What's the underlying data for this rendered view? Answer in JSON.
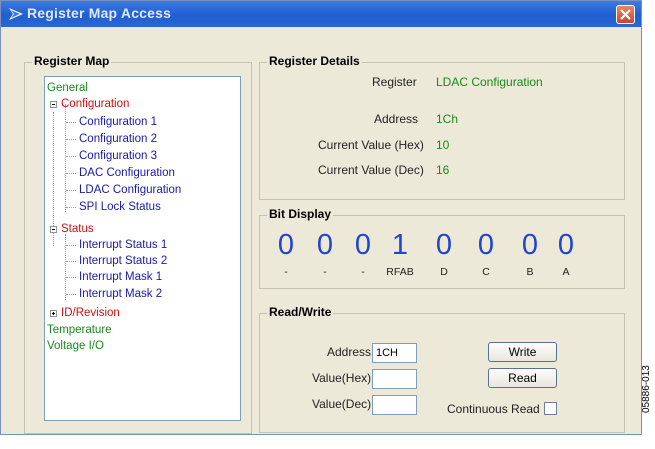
{
  "window": {
    "title": "Register Map Access",
    "close_icon": "close-icon"
  },
  "register_map": {
    "label": "Register Map",
    "items": [
      {
        "text": "General",
        "color": "#1a8a1a"
      },
      {
        "text": "Configuration",
        "color": "#cc1111",
        "expanded": true
      },
      {
        "text": "Configuration 1",
        "color": "#1a1aa8"
      },
      {
        "text": "Configuration 2",
        "color": "#1a1aa8"
      },
      {
        "text": "Configuration 3",
        "color": "#1a1aa8"
      },
      {
        "text": "DAC Configuration",
        "color": "#1a1aa8"
      },
      {
        "text": "LDAC Configuration",
        "color": "#1a1aa8"
      },
      {
        "text": "SPI Lock Status",
        "color": "#1a1aa8"
      },
      {
        "text": "Status",
        "color": "#cc1111",
        "expanded": true
      },
      {
        "text": "Interrupt Status 1",
        "color": "#1a1aa8"
      },
      {
        "text": "Interrupt Status 2",
        "color": "#1a1aa8"
      },
      {
        "text": "Interrupt Mask 1",
        "color": "#1a1aa8"
      },
      {
        "text": "Interrupt Mask 2",
        "color": "#1a1aa8"
      },
      {
        "text": "ID/Revision",
        "color": "#cc1111",
        "expanded": false
      },
      {
        "text": "Temperature",
        "color": "#1a8a1a"
      },
      {
        "text": "Voltage I/O",
        "color": "#1a8a1a"
      }
    ]
  },
  "register_details": {
    "label": "Register Details",
    "rows": [
      {
        "label": "Register",
        "value": "LDAC Configuration"
      },
      {
        "label": "Address",
        "value": "1Ch"
      },
      {
        "label": "Current Value (Hex)",
        "value": "10"
      },
      {
        "label": "Current Value (Dec)",
        "value": "16"
      }
    ]
  },
  "bit_display": {
    "label": "Bit Display",
    "bits": [
      {
        "value": "0",
        "name": "-"
      },
      {
        "value": "0",
        "name": "-"
      },
      {
        "value": "0",
        "name": "-"
      },
      {
        "value": "1",
        "name": "RFAB"
      },
      {
        "value": "0",
        "name": "D"
      },
      {
        "value": "0",
        "name": "C"
      },
      {
        "value": "0",
        "name": "B"
      },
      {
        "value": "0",
        "name": "A"
      }
    ]
  },
  "read_write": {
    "label": "Read/Write",
    "address_label": "Address",
    "address_value": "1CH",
    "value_hex_label": "Value(Hex)",
    "value_hex_value": "",
    "value_dec_label": "Value(Dec)",
    "value_dec_value": "",
    "write_label": "Write",
    "read_label": "Read",
    "continuous_read_label": "Continuous Read",
    "continuous_read_checked": false
  },
  "figure_code": "05886-013",
  "colors": {
    "title_bar": "#2a66d8",
    "window_bg": "#ece9d8",
    "bit_digit": "#2244cc",
    "value_green": "#1a8a1a"
  }
}
